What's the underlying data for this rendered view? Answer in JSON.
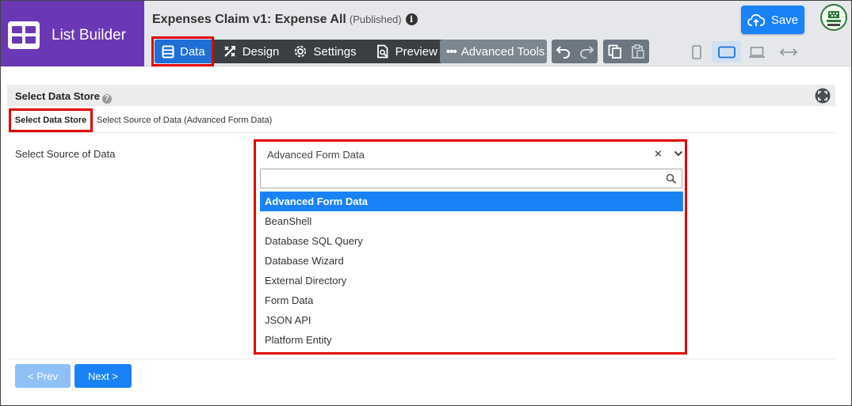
{
  "app": {
    "title": "List Builder"
  },
  "document": {
    "title": "Expenses Claim v1: Expense All",
    "status": "(Published)",
    "info_glyph": "i"
  },
  "toolbar": {
    "tabs": [
      {
        "label": "Data",
        "icon": "data-icon",
        "active": true
      },
      {
        "label": "Design",
        "icon": "design-icon",
        "active": false
      },
      {
        "label": "Settings",
        "icon": "gear-icon",
        "active": false
      },
      {
        "label": "Preview",
        "icon": "preview-icon",
        "active": false
      }
    ],
    "advanced_label": "Advanced Tools",
    "save_label": "Save",
    "devices": [
      "phone-icon",
      "tablet-icon",
      "laptop-icon",
      "fullwidth-icon"
    ],
    "active_device": "tablet-icon"
  },
  "panel": {
    "title": "Select Data Store",
    "help_glyph": "?",
    "breadcrumb_active": "Select Data Store",
    "breadcrumb_next": "Select Source of Data (Advanced Form Data)"
  },
  "form": {
    "label": "Select Source of Data",
    "selected_value": "Advanced Form Data",
    "clear_glyph": "×",
    "search_placeholder": "",
    "options": [
      "Advanced Form Data",
      "BeanShell",
      "Database SQL Query",
      "Database Wizard",
      "External Directory",
      "Form Data",
      "JSON API",
      "Platform Entity"
    ],
    "selected_index": 0
  },
  "nav": {
    "prev_label": "< Prev",
    "next_label": "Next >"
  },
  "colors": {
    "brand": "#6a37b6",
    "accent": "#1a82f7",
    "highlight": "#e00000",
    "toolbar_dark": "#3b3f44"
  }
}
